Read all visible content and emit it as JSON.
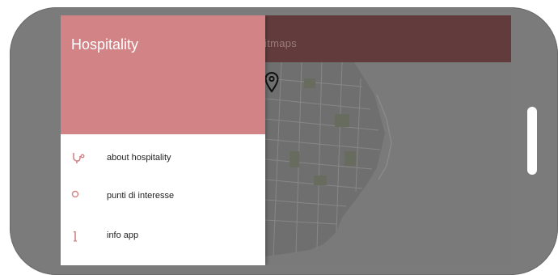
{
  "app_bar": {
    "title": "itmaps"
  },
  "drawer": {
    "title": "Hospitality",
    "items": [
      {
        "label": "about hospitality",
        "icon": "stethoscope-icon"
      },
      {
        "label": "punti di interesse",
        "icon": "circle-icon"
      },
      {
        "label": "info app",
        "icon": "info-icon"
      }
    ]
  },
  "colors": {
    "accent": "#d18385",
    "app_bar": "#623c3d",
    "scrim": "#7a7a7a"
  }
}
